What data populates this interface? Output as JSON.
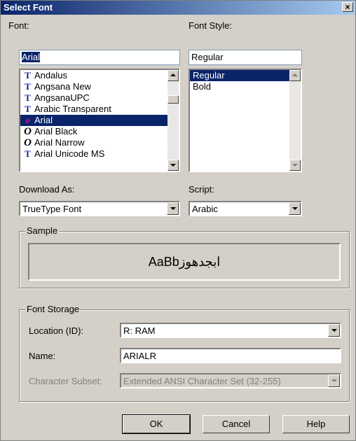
{
  "window": {
    "title": "Select Font",
    "close_label": "×"
  },
  "font": {
    "label": "Font:",
    "value": "Arial",
    "items": [
      {
        "name": "Andalus",
        "icon": "truetype-icon"
      },
      {
        "name": "Angsana New",
        "icon": "truetype-icon"
      },
      {
        "name": "AngsanaUPC",
        "icon": "truetype-icon"
      },
      {
        "name": "Arabic Transparent",
        "icon": "truetype-icon"
      },
      {
        "name": "Arial",
        "icon": "symbol-font-icon",
        "selected": true
      },
      {
        "name": "Arial Black",
        "icon": "opentype-icon"
      },
      {
        "name": "Arial Narrow",
        "icon": "opentype-icon"
      },
      {
        "name": "Arial Unicode MS",
        "icon": "truetype-icon"
      }
    ]
  },
  "font_style": {
    "label": "Font Style:",
    "value": "Regular",
    "items": [
      {
        "name": "Regular",
        "selected": true
      },
      {
        "name": "Bold"
      }
    ]
  },
  "download_as": {
    "label": "Download As:",
    "value": "TrueType Font"
  },
  "script": {
    "label": "Script:",
    "value": "Arabic"
  },
  "sample": {
    "label": "Sample",
    "text": "AaBbابجدهوز"
  },
  "storage": {
    "label": "Font Storage",
    "location_label": "Location (ID):",
    "location_value": "R: RAM",
    "name_label": "Name:",
    "name_value": "ARIALR",
    "subset_label": "Character Subset:",
    "subset_value": "Extended ANSI Character Set (32-255)"
  },
  "buttons": {
    "ok": "OK",
    "cancel": "Cancel",
    "help": "Help"
  }
}
